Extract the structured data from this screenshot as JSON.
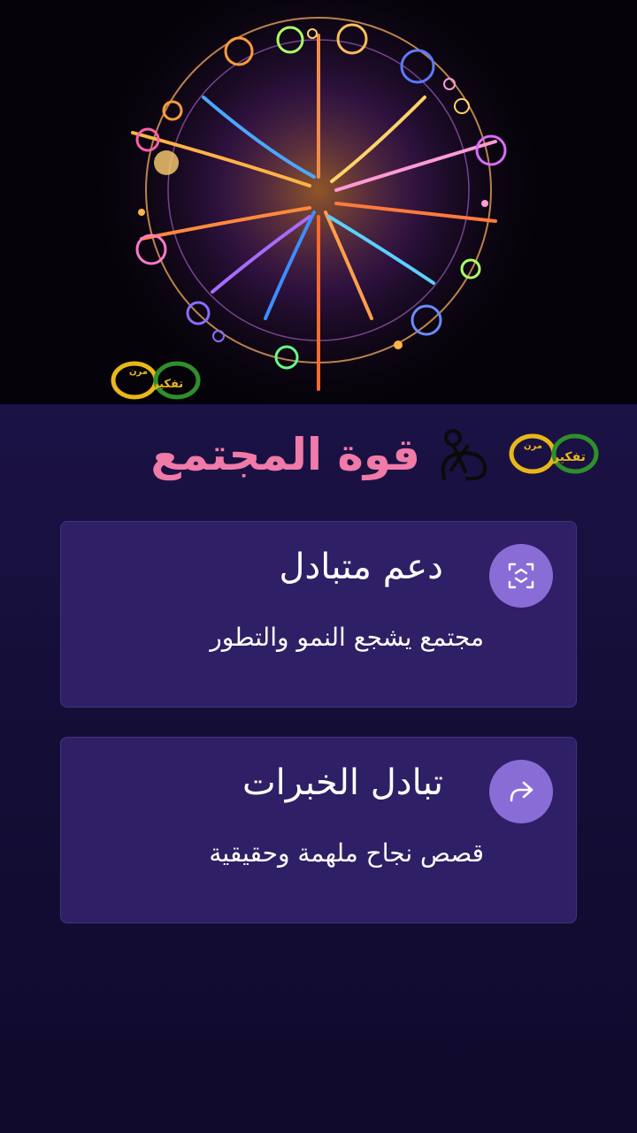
{
  "header": {
    "title": "قوة المجتمع",
    "logo_text_top": "مرن",
    "logo_text_bottom": "تفكير"
  },
  "hero": {
    "logo_text_top": "مرن",
    "logo_text_bottom": "تفكير"
  },
  "cards": [
    {
      "icon": "exchange-arrows-icon",
      "title": "دعم متبادل",
      "subtitle": "مجتمع يشجع النمو والتطور"
    },
    {
      "icon": "share-forward-icon",
      "title": "تبادل الخبرات",
      "subtitle": "قصص نجاح ملهمة وحقيقية"
    }
  ],
  "colors": {
    "background": "#130c30",
    "card": "#2e1f66",
    "icon_circle": "#8a6cd6",
    "title_pink": "#f07aa8",
    "logo_green": "#2f8f2a",
    "logo_yellow": "#e9b818"
  }
}
